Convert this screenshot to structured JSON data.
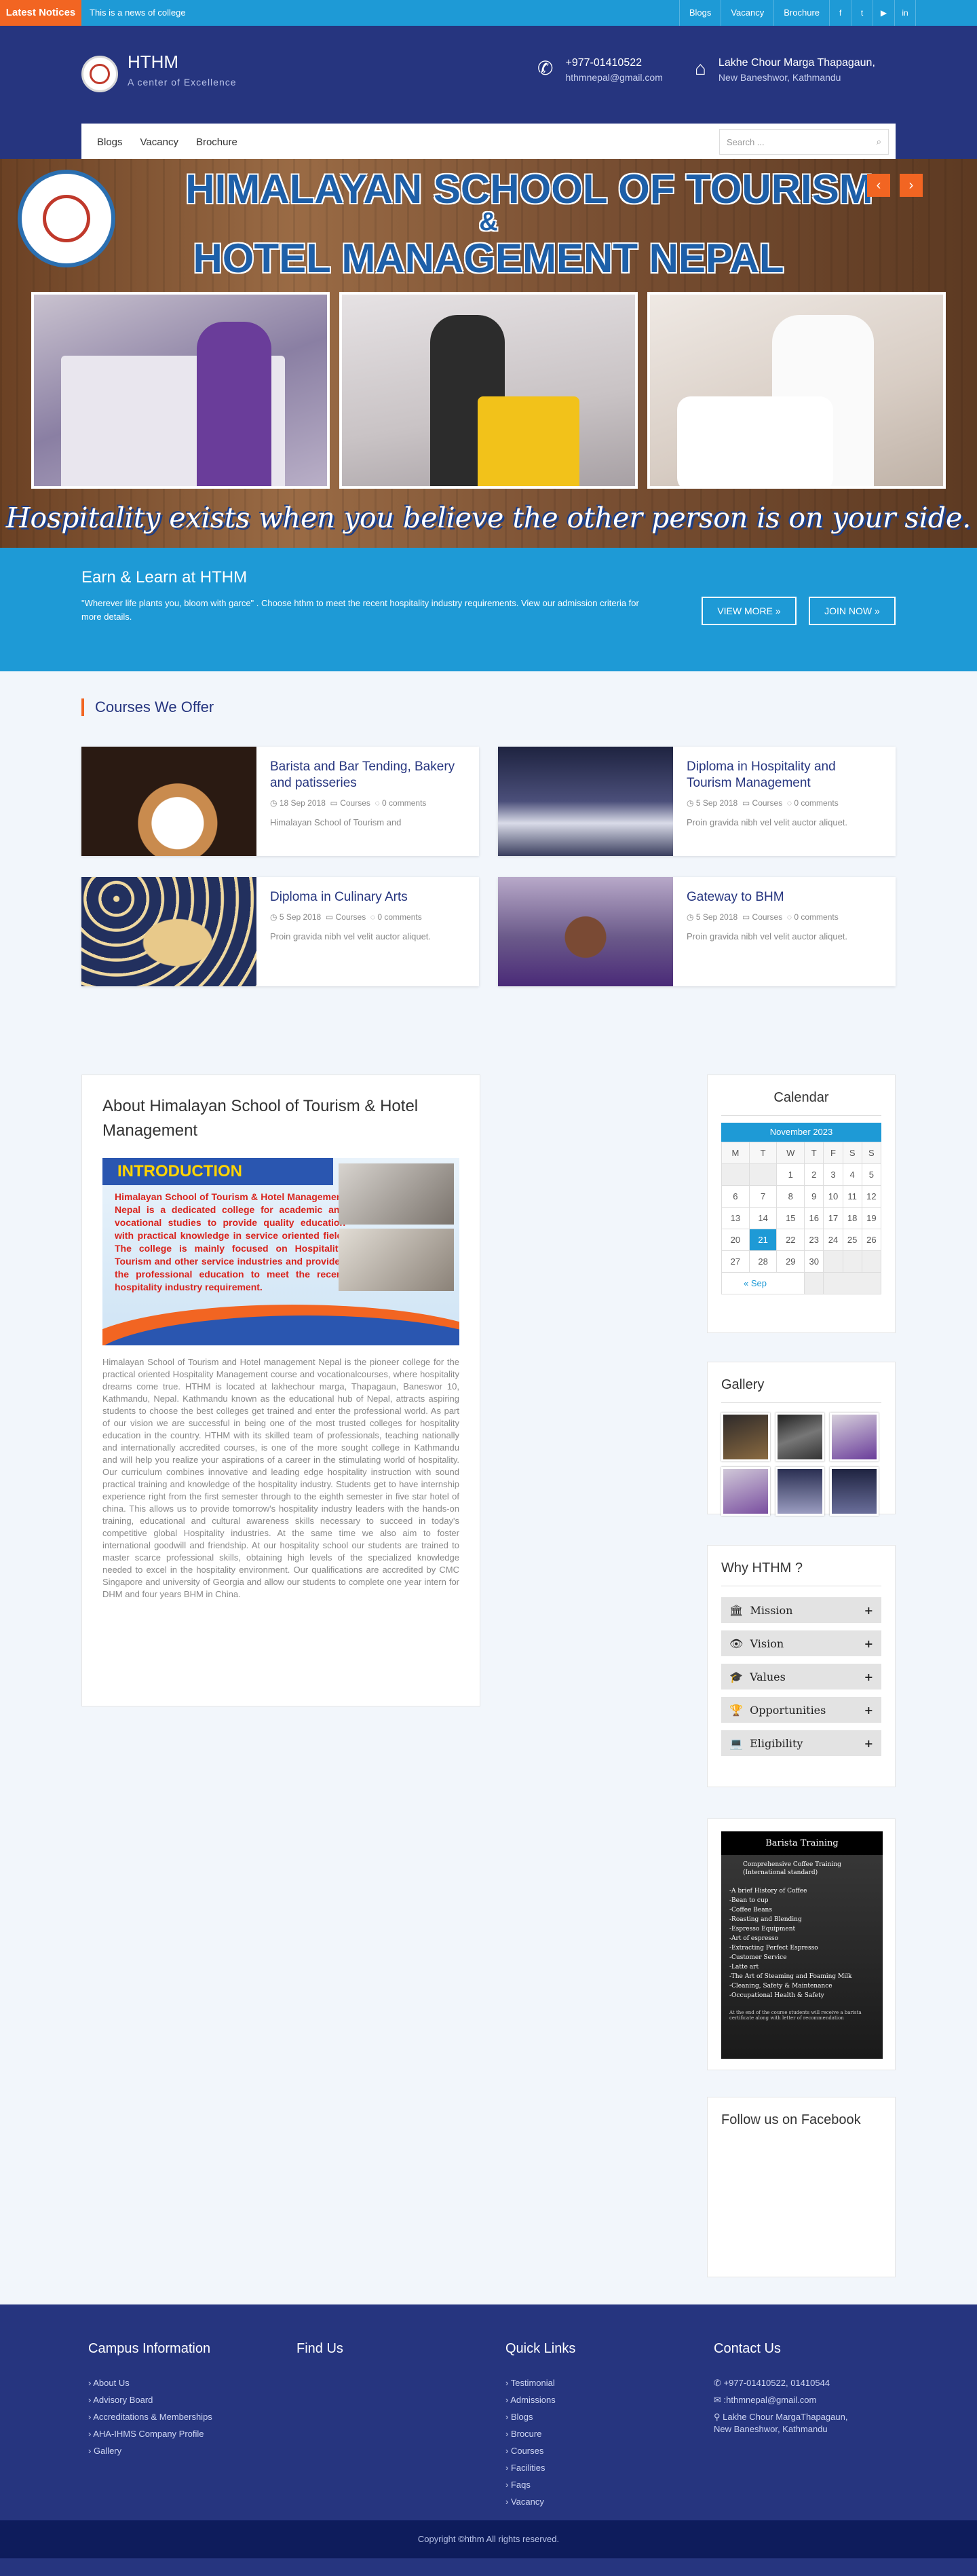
{
  "topbar": {
    "notice_label": "Latest Notices",
    "notice_text": "This is a news of college",
    "links": [
      "Blogs",
      "Vacancy",
      "Brochure"
    ],
    "social_icons": [
      "facebook-icon",
      "twitter-icon",
      "youtube-icon",
      "linkedin-icon"
    ],
    "social_glyphs": [
      "f",
      "t",
      "▶",
      "in"
    ]
  },
  "header": {
    "brand": "HTHM",
    "tagline": "A center of Excellence",
    "phone": "+977-01410522",
    "email": "hthmnepal@gmail.com",
    "address1": "Lakhe Chour Marga Thapagaun,",
    "address2": "New Baneshwor, Kathmandu"
  },
  "nav": {
    "items": [
      "Blogs",
      "Vacancy",
      "Brochure"
    ],
    "search_placeholder": "Search ..."
  },
  "banner": {
    "title1": "HIMALAYAN SCHOOL OF TOURISM",
    "amp": "&",
    "title2": "HOTEL MANAGEMENT NEPAL",
    "tagline": "Hospitality exists when you believe the other person is on your side.",
    "prev": "‹",
    "next": "›"
  },
  "earn": {
    "title": "Earn & Learn at HTHM",
    "text": "\"Wherever life plants you, bloom with garce\" . Choose hthm to meet the recent hospitality industry requirements. View our admission criteria for more details.",
    "btn_more": "VIEW MORE »",
    "btn_join": "JOIN NOW »"
  },
  "courses": {
    "title": "Courses We Offer",
    "items": [
      {
        "title": "Barista and Bar Tending, Bakery and patisseries",
        "date": "18 Sep 2018",
        "category": "Courses",
        "comments": "0 comments",
        "excerpt": "Himalayan School of Tourism and"
      },
      {
        "title": "Diploma in Hospitality and Tourism Management",
        "date": "5 Sep 2018",
        "category": "Courses",
        "comments": "0 comments",
        "excerpt": "Proin gravida nibh vel velit auctor aliquet."
      },
      {
        "title": "Diploma in Culinary Arts",
        "date": "5 Sep 2018",
        "category": "Courses",
        "comments": "0 comments",
        "excerpt": "Proin gravida nibh vel velit auctor aliquet."
      },
      {
        "title": "Gateway to BHM",
        "date": "5 Sep 2018",
        "category": "Courses",
        "comments": "0 comments",
        "excerpt": "Proin gravida nibh vel velit auctor aliquet."
      }
    ]
  },
  "about": {
    "title": "About Himalayan School of Tourism & Hotel Management",
    "intro_head": "INTRODUCTION",
    "intro_text": "Himalayan School of Tourism & Hotel Management Nepal is a dedicated college for academic and vocational studies to provide quality education with practical knowledge in service oriented field. The college is mainly focused on Hospitality, Tourism and other service industries and provides the professional education to meet the recent hospitality industry requirement.",
    "body": "Himalayan School of Tourism and Hotel management Nepal is the pioneer college for the practical oriented Hospitality Management course and vocationalcourses, where hospitality dreams come true. HTHM is located at lakhechour marga, Thapagaun, Baneswor 10, Kathmandu, Nepal. Kathmandu known as the educational hub of Nepal, attracts aspiring students to choose the best colleges get trained and enter the professional world. As part of our vision we are successful in being one of the most trusted colleges for hospitality education in the country. HTHM with its skilled team of professionals, teaching nationally and internationally accredited courses, is one of the more sought college in Kathmandu and will help you realize your aspirations of a career in the stimulating world of hospitality. Our curriculum combines innovative and leading edge hospitality instruction with sound practical training and knowledge of the hospitality industry. Students get to have internship experience right from the first semester through to the eighth semester in five star hotel of china. This allows us to provide tomorrow's hospitality industry leaders with the hands-on training, educational and cultural awareness skills necessary to succeed in today's competitive global Hospitality industries. At the same time we also aim to foster international goodwill and friendship. At our hospitality school our students are trained to master scarce professional skills, obtaining high levels of the specialized knowledge needed to excel in the hospitality environment. Our qualifications are accredited by CMC Singapore and university of Georgia and allow our students to complete one year intern for DHM and four years BHM in China."
  },
  "calendar": {
    "title": "Calendar",
    "month": "November 2023",
    "days": [
      "M",
      "T",
      "W",
      "T",
      "F",
      "S",
      "S"
    ],
    "weeks": [
      [
        "",
        "",
        "1",
        "2",
        "3",
        "4",
        "5"
      ],
      [
        "6",
        "7",
        "8",
        "9",
        "10",
        "11",
        "12"
      ],
      [
        "13",
        "14",
        "15",
        "16",
        "17",
        "18",
        "19"
      ],
      [
        "20",
        "21",
        "22",
        "23",
        "24",
        "25",
        "26"
      ],
      [
        "27",
        "28",
        "29",
        "30",
        "",
        "",
        ""
      ]
    ],
    "today": "21",
    "prev": "« Sep"
  },
  "gallery": {
    "title": "Gallery"
  },
  "why": {
    "title": "Why HTHM ?",
    "items": [
      {
        "label": "Mission",
        "icon": "bank-icon",
        "glyph": "🏛"
      },
      {
        "label": "Vision",
        "icon": "eye-icon",
        "glyph": "👁"
      },
      {
        "label": "Values",
        "icon": "graduation-cap-icon",
        "glyph": "🎓"
      },
      {
        "label": "Opportunities",
        "icon": "trophy-icon",
        "glyph": "🏆"
      },
      {
        "label": "Eligibility",
        "icon": "laptop-icon",
        "glyph": "💻"
      }
    ],
    "toggle": "+"
  },
  "barista": {
    "title": "Barista Training",
    "subtitle": "Comprehensive Coffee Training (International standard)",
    "lines": [
      "-A brief History of Coffee",
      "-Bean to cup",
      "-Coffee Beans",
      "-Roasting and Blending",
      "-Espresso Equipment",
      "-Art of espresso",
      "-Extracting Perfect Espresso",
      "-Customer Service",
      "-Latte art",
      "-The Art of Steaming and Foaming Milk",
      "-Cleaning, Safety & Maintenance",
      "-Occupational Health & Safety"
    ],
    "note": "At the end of the course students will receive a barista certificate along with letter of recommendation"
  },
  "facebook": {
    "title": "Follow us on Facebook"
  },
  "footer": {
    "campus": {
      "title": "Campus Information",
      "items": [
        "About Us",
        "Advisory Board",
        "Accreditations & Memberships",
        "AHA-IHMS Company Profile",
        "Gallery"
      ]
    },
    "find": {
      "title": "Find Us"
    },
    "quick": {
      "title": "Quick Links",
      "items": [
        "Testimonial",
        "Admissions",
        "Blogs",
        "Brocure",
        "Courses",
        "Facilities",
        "Faqs",
        "Vacancy"
      ]
    },
    "contact": {
      "title": "Contact Us",
      "phone": "+977-01410522, 01410544",
      "email": "hthmnepal@gmail.com",
      "address1": "Lakhe Chour MargaThapagaun,",
      "address2": "New Baneshwor, Kathmandu"
    },
    "copyright": "Copyright ©hthm All rights reserved."
  },
  "colors": {
    "primary": "#26357f",
    "accent": "#1e9ad6",
    "orange": "#f26522"
  }
}
